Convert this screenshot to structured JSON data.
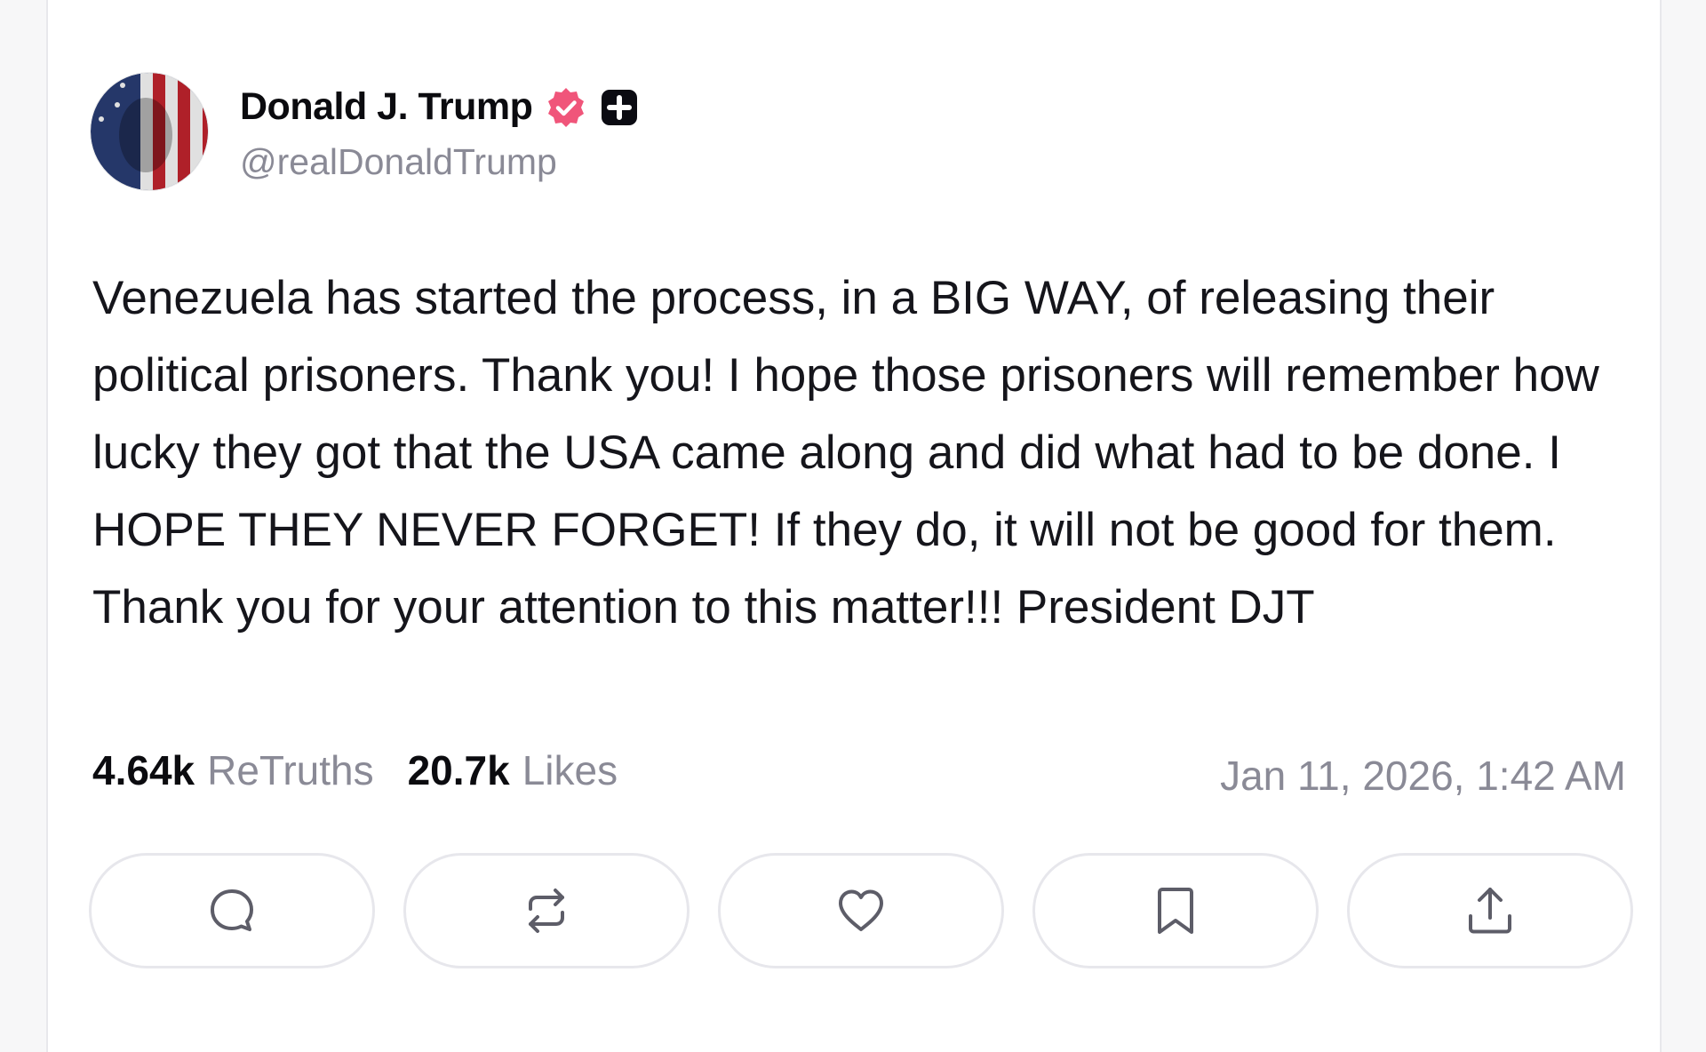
{
  "author": {
    "display_name": "Donald J. Trump",
    "handle": "@realDonaldTrump",
    "avatar_icon": "flag-portrait-avatar",
    "verified_icon": "verified-badge-icon",
    "verified_color": "#f0557a",
    "plus_badge_icon": "plus-badge-icon"
  },
  "post": {
    "text": "Venezuela has started the process, in a BIG WAY, of releasing their political prisoners. Thank you! I hope those prisoners will remember how lucky they got that the USA came along and did what had to be done. I HOPE THEY NEVER FORGET! If they do, it will not be good for them. Thank you for your attention to this matter!!! President DJT",
    "timestamp": "Jan 11, 2026, 1:42 AM"
  },
  "stats": {
    "retruths_count": "4.64k",
    "retruths_label": "ReTruths",
    "likes_count": "20.7k",
    "likes_label": "Likes"
  },
  "actions": [
    {
      "name": "reply",
      "icon": "comment-icon"
    },
    {
      "name": "retruth",
      "icon": "repost-icon"
    },
    {
      "name": "like",
      "icon": "heart-icon"
    },
    {
      "name": "bookmark",
      "icon": "bookmark-icon"
    },
    {
      "name": "share",
      "icon": "share-icon"
    }
  ],
  "colors": {
    "text_primary": "#15151b",
    "text_secondary": "#8a8a96",
    "border": "#e7e7ec"
  }
}
